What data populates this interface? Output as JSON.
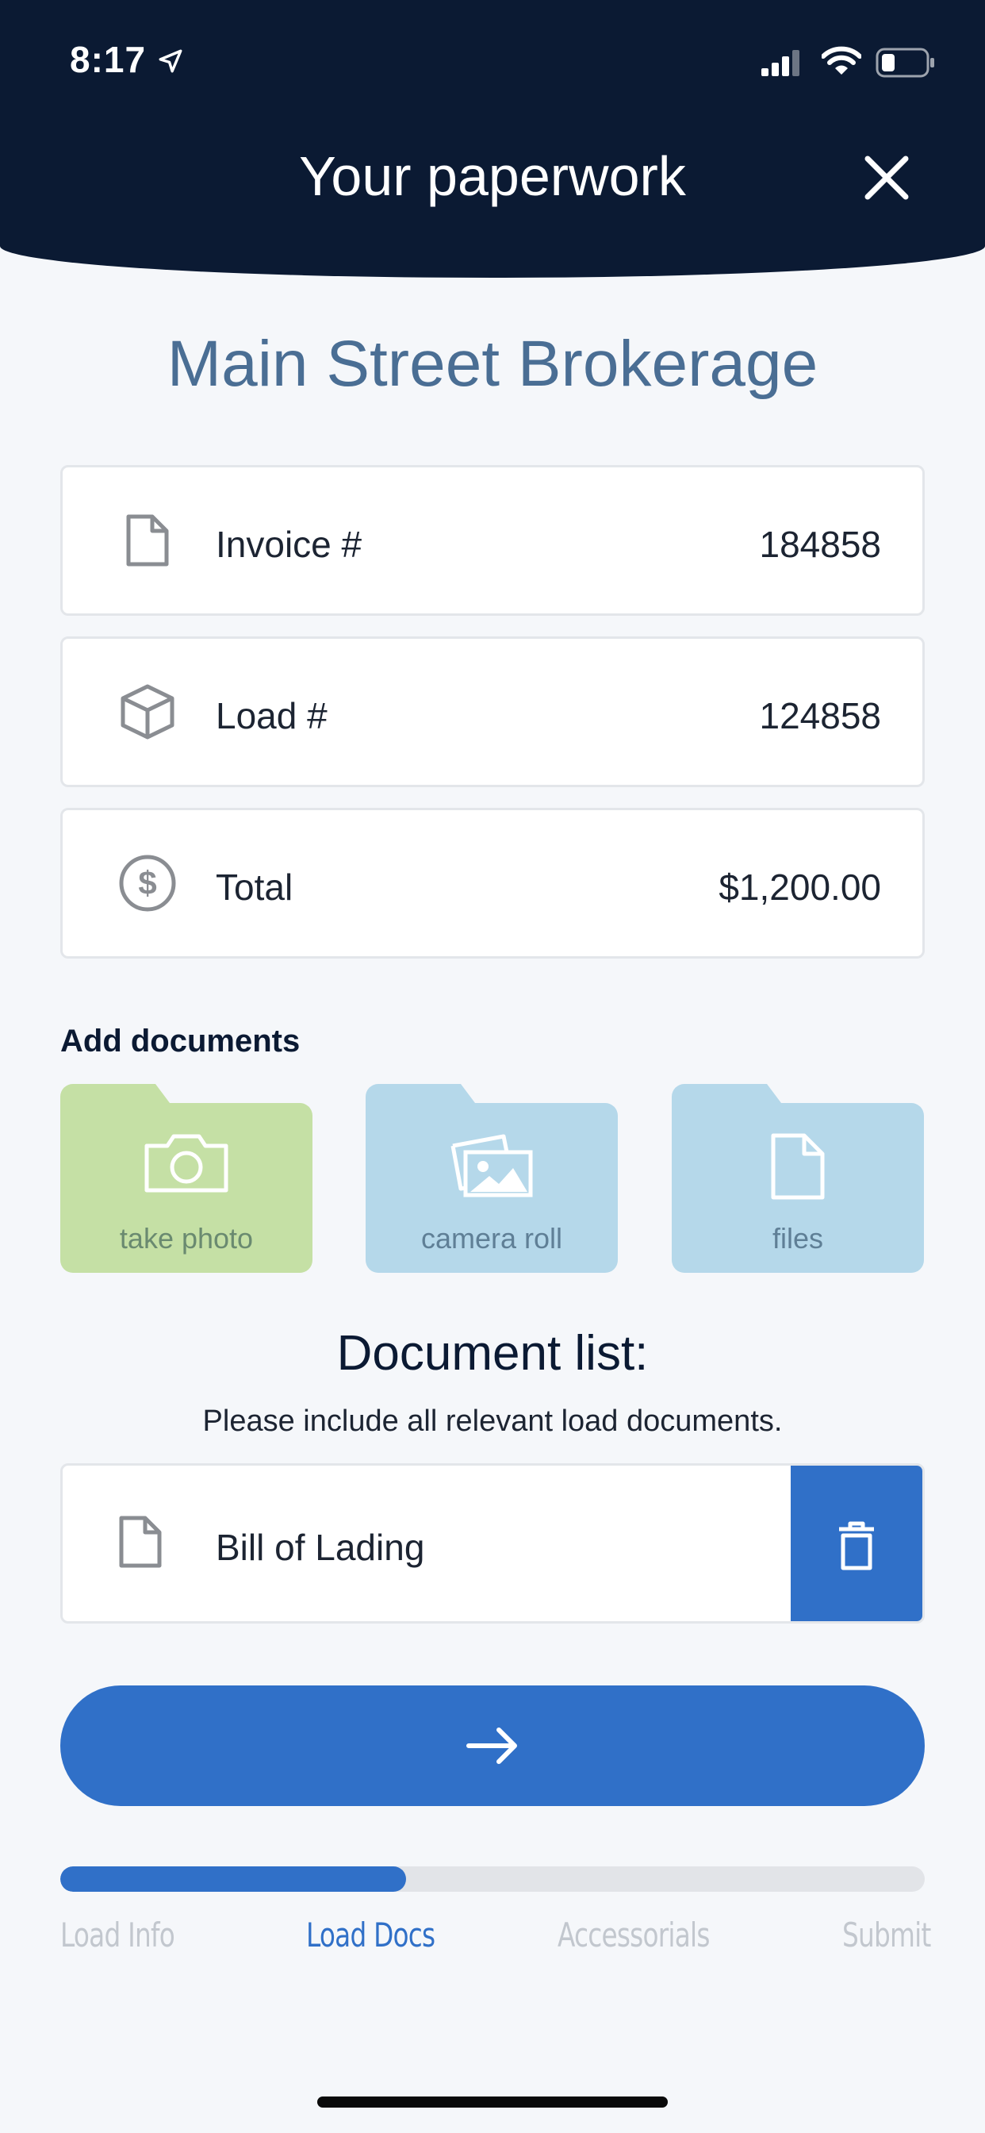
{
  "status_bar": {
    "time": "8:17"
  },
  "header": {
    "title": "Your paperwork"
  },
  "brokerage_name": "Main Street Brokerage",
  "info_cards": [
    {
      "icon": "document-icon",
      "label": "Invoice #",
      "value": "184858"
    },
    {
      "icon": "box-icon",
      "label": "Load #",
      "value": "124858"
    },
    {
      "icon": "dollar-icon",
      "label": "Total",
      "value": "$1,200.00"
    }
  ],
  "add_documents": {
    "label": "Add documents",
    "options": [
      {
        "icon": "camera-icon",
        "label": "take photo",
        "color": "#c5e0a5"
      },
      {
        "icon": "photos-icon",
        "label": "camera roll",
        "color": "#b5d8ea"
      },
      {
        "icon": "file-icon",
        "label": "files",
        "color": "#b5d8ea"
      }
    ]
  },
  "document_list": {
    "title": "Document list:",
    "subtitle": "Please include all relevant load documents.",
    "items": [
      {
        "label": "Bill of Lading"
      }
    ]
  },
  "progress": {
    "fraction": 0.4,
    "steps": [
      "Load Info",
      "Load Docs",
      "Accessorials",
      "Submit"
    ],
    "active_step": "Load Docs"
  },
  "colors": {
    "header_bg": "#0b1a33",
    "accent": "#3070c8",
    "brokerage_text": "#4a6e94"
  }
}
